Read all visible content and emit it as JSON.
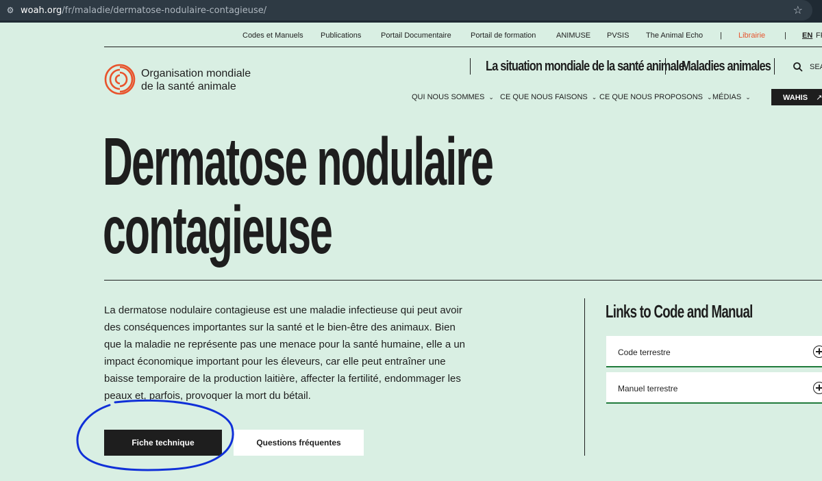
{
  "browser": {
    "url_host": "woah.org",
    "url_path": "/fr/maladie/dermatose-nodulaire-contagieuse/",
    "site_icon": "tune-icon",
    "bookmark_icon": "star-icon"
  },
  "utility_nav": {
    "items": [
      "Codes et Manuels",
      "Publications",
      "Portail Documentaire",
      "Portail de formation",
      "ANIMUSE",
      "PVSIS",
      "The Animal Echo"
    ],
    "librairie": "Librairie",
    "lang_en": "EN",
    "lang_fr": "FR"
  },
  "logo": {
    "line1": "Organisation mondiale",
    "line2": "de la santé animale",
    "color": "#e8532c"
  },
  "header": {
    "situation_link": "La situation mondiale de la santé animale",
    "maladies_link": "Maladies animales",
    "search_label": "SEA"
  },
  "main_menu": {
    "items": [
      "QUI NOUS SOMMES",
      "CE QUE NOUS FAISONS",
      "CE QUE NOUS PROPOSONS",
      "MÉDIAS"
    ],
    "chevron": "⌄",
    "wahis": "WAHIS",
    "wahis_arrow": "↗"
  },
  "page": {
    "title_line1": "Dermatose nodulaire",
    "title_line2": "contagieuse",
    "intro": "La dermatose nodulaire contagieuse est une maladie infectieuse qui peut avoir des conséquences importantes sur la santé et le bien-être des animaux. Bien que la maladie ne représente pas une menace pour la santé humaine, elle a un impact économique important pour les éleveurs, car elle peut entraîner une baisse temporaire de la production laitière, affecter la fertilité, endommager les peaux et, parfois, provoquer la mort du bétail.",
    "btn_fiche": "Fiche technique",
    "btn_questions": "Questions fréquentes"
  },
  "links_panel": {
    "title": "Links to Code and Manual",
    "items": [
      "Code terrestre",
      "Manuel terrestre"
    ],
    "accent": "#1f7a3a"
  },
  "annotation": {
    "color": "#1030d8"
  }
}
